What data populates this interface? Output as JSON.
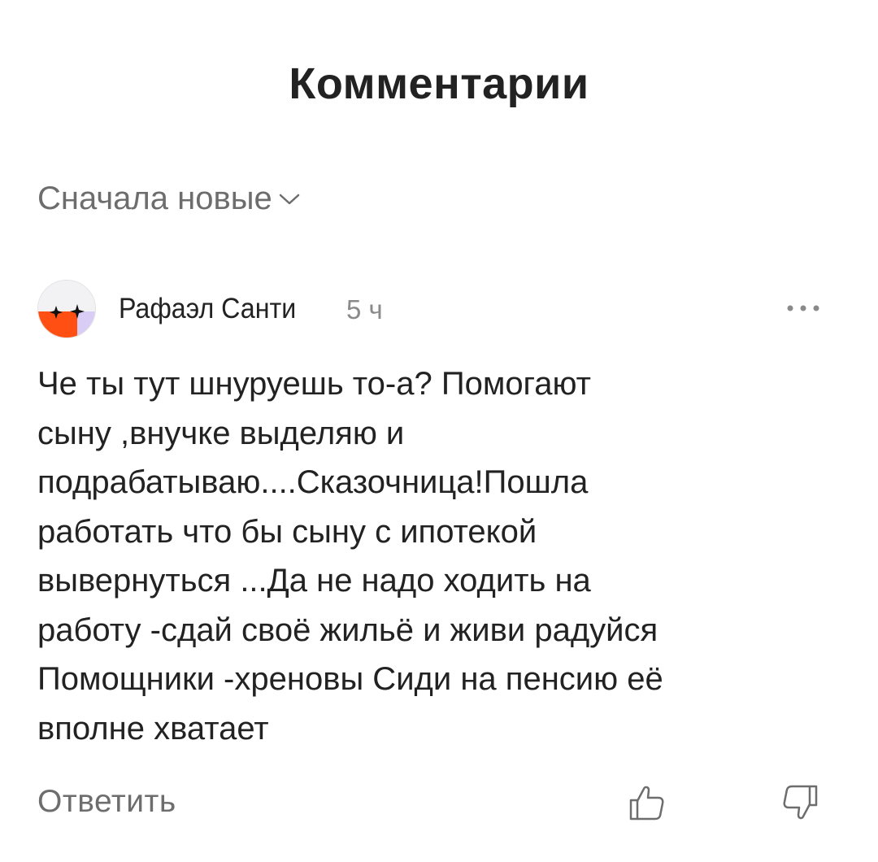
{
  "header": {
    "title": "Комментарии"
  },
  "sort": {
    "label": "Сначала новые",
    "icon": "chevron-down-icon"
  },
  "comment": {
    "author": "Рафаэл Санти",
    "time": "5 ч",
    "avatar_colors": {
      "top": "#f2f2f4",
      "bottom_left": "#ff4f12",
      "bottom_right": "#d9ccf5",
      "sparkle": "#111111"
    },
    "text_lines": [
      "Че ты тут шнуруешь то-а? Помогают",
      "сыну ,внучке выделяю и",
      "подрабатываю....Сказочница!Пошла",
      "работать что бы сыну с ипотекой",
      "вывернуться ...Да не надо ходить на",
      "работу -сдай своё жильё и живи радуйся",
      "Помощники -хреновы Сиди на пенсию её",
      "вполне хватает"
    ],
    "actions": {
      "reply_label": "Ответить",
      "like_icon": "thumbs-up-icon",
      "dislike_icon": "thumbs-down-icon",
      "more_icon": "more-dots-icon"
    }
  }
}
